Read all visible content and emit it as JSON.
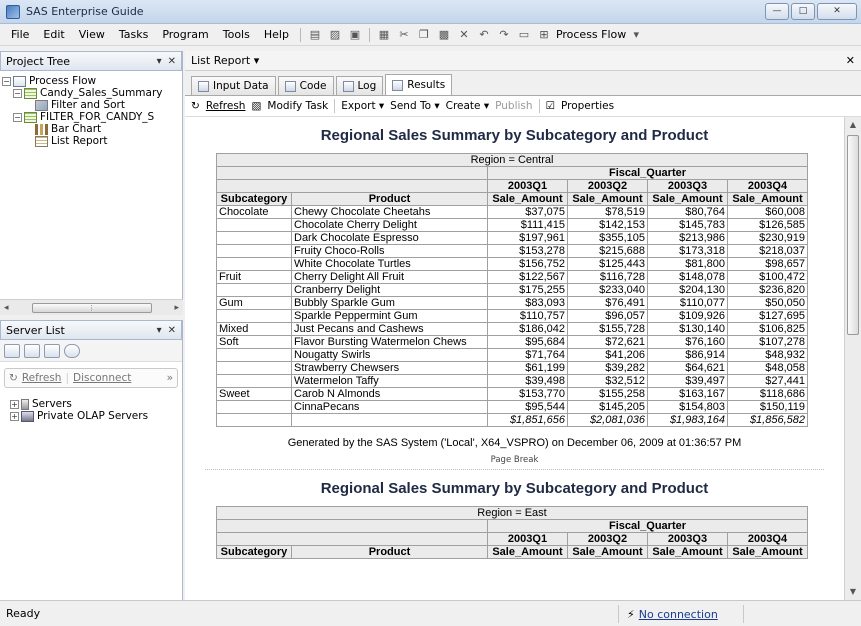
{
  "window": {
    "title": "SAS Enterprise Guide",
    "min": "—",
    "max": "□",
    "close": "✕"
  },
  "menu": [
    {
      "label": "File"
    },
    {
      "label": "Edit"
    },
    {
      "label": "View"
    },
    {
      "label": "Tasks"
    },
    {
      "label": "Program"
    },
    {
      "label": "Tools"
    },
    {
      "label": "Help"
    }
  ],
  "toolbar": {
    "process_flow_label": "Process Flow"
  },
  "project_tree": {
    "title": "Project Tree",
    "items": [
      {
        "label": "Process Flow",
        "icon": "process-flow-icon",
        "level": 0
      },
      {
        "label": "Candy_Sales_Summary",
        "icon": "table-icon",
        "level": 1
      },
      {
        "label": "Filter and Sort",
        "icon": "filter-icon",
        "level": 2
      },
      {
        "label": "FILTER_FOR_CANDY_S",
        "icon": "table-icon",
        "level": 1
      },
      {
        "label": "Bar Chart",
        "icon": "bar-chart-icon",
        "level": 2
      },
      {
        "label": "List Report",
        "icon": "list-report-icon",
        "level": 2
      }
    ]
  },
  "server_list": {
    "title": "Server List",
    "refresh": "Refresh",
    "disconnect": "Disconnect",
    "items": [
      {
        "label": "Servers"
      },
      {
        "label": "Private OLAP Servers"
      }
    ]
  },
  "document": {
    "header": "List Report"
  },
  "tabs": [
    {
      "label": "Input Data",
      "active": false
    },
    {
      "label": "Code",
      "active": false
    },
    {
      "label": "Log",
      "active": false
    },
    {
      "label": "Results",
      "active": true
    }
  ],
  "results_toolbar": {
    "refresh": "Refresh",
    "modify": "Modify Task",
    "export": "Export",
    "sendto": "Send To",
    "create": "Create",
    "publish": "Publish",
    "properties": "Properties"
  },
  "report": {
    "title": "Regional Sales Summary by Subcategory and Product",
    "region_central": "Region = Central",
    "region_east": "Region = East",
    "fiscal_quarter": "Fiscal_Quarter",
    "quarters": [
      "2003Q1",
      "2003Q2",
      "2003Q3",
      "2003Q4"
    ],
    "col_subcategory": "Subcategory",
    "col_product": "Product",
    "col_sale_amount": "Sale_Amount",
    "rows": [
      {
        "sub": "Chocolate",
        "product": "Chewy Chocolate Cheetahs",
        "q": [
          "$37,075",
          "$78,519",
          "$80,764",
          "$60,008"
        ]
      },
      {
        "sub": "",
        "product": "Chocolate Cherry Delight",
        "q": [
          "$111,415",
          "$142,153",
          "$145,783",
          "$126,585"
        ]
      },
      {
        "sub": "",
        "product": "Dark Chocolate Espresso",
        "q": [
          "$197,961",
          "$355,105",
          "$213,986",
          "$230,919"
        ]
      },
      {
        "sub": "",
        "product": "Fruity Choco-Rolls",
        "q": [
          "$153,278",
          "$215,688",
          "$173,318",
          "$218,037"
        ]
      },
      {
        "sub": "",
        "product": "White Chocolate Turtles",
        "q": [
          "$156,752",
          "$125,443",
          "$81,800",
          "$98,657"
        ]
      },
      {
        "sub": "Fruit",
        "product": "Cherry Delight All Fruit",
        "q": [
          "$122,567",
          "$116,728",
          "$148,078",
          "$100,472"
        ]
      },
      {
        "sub": "",
        "product": "Cranberry Delight",
        "q": [
          "$175,255",
          "$233,040",
          "$204,130",
          "$236,820"
        ]
      },
      {
        "sub": "Gum",
        "product": "Bubbly Sparkle Gum",
        "q": [
          "$83,093",
          "$76,491",
          "$110,077",
          "$50,050"
        ]
      },
      {
        "sub": "",
        "product": "Sparkle Peppermint Gum",
        "q": [
          "$110,757",
          "$96,057",
          "$109,926",
          "$127,695"
        ]
      },
      {
        "sub": "Mixed",
        "product": "Just Pecans and Cashews",
        "q": [
          "$186,042",
          "$155,728",
          "$130,140",
          "$106,825"
        ]
      },
      {
        "sub": "Soft",
        "product": "Flavor Bursting Watermelon Chews",
        "q": [
          "$95,684",
          "$72,621",
          "$76,160",
          "$107,278"
        ]
      },
      {
        "sub": "",
        "product": "Nougatty Swirls",
        "q": [
          "$71,764",
          "$41,206",
          "$86,914",
          "$48,932"
        ]
      },
      {
        "sub": "",
        "product": "Strawberry Chewsers",
        "q": [
          "$61,199",
          "$39,282",
          "$64,621",
          "$48,058"
        ]
      },
      {
        "sub": "",
        "product": "Watermelon Taffy",
        "q": [
          "$39,498",
          "$32,512",
          "$39,497",
          "$27,441"
        ]
      },
      {
        "sub": "Sweet",
        "product": "Carob N Almonds",
        "q": [
          "$153,770",
          "$155,258",
          "$163,167",
          "$118,686"
        ]
      },
      {
        "sub": "",
        "product": "CinnaPecans",
        "q": [
          "$95,544",
          "$145,205",
          "$154,803",
          "$150,119"
        ]
      }
    ],
    "totals": [
      "$1,851,656",
      "$2,081,036",
      "$1,983,164",
      "$1,856,582"
    ],
    "footnote": "Generated by the SAS System ('Local', X64_VSPRO) on December 06, 2009 at 01:36:57 PM",
    "page_break": "Page Break"
  },
  "status": {
    "text": "Ready",
    "connection": "No connection"
  }
}
